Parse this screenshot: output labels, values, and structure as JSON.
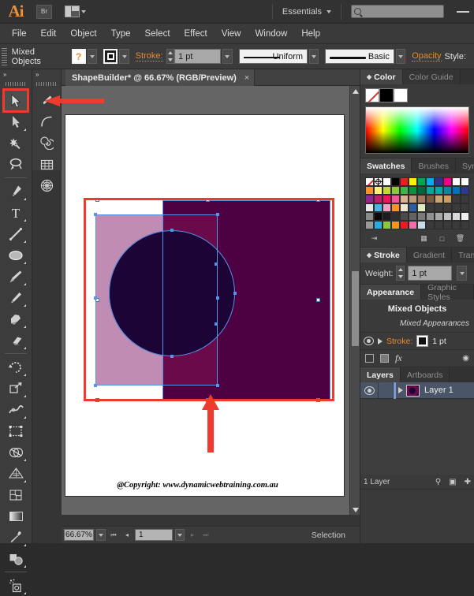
{
  "app": {
    "name": "Ai",
    "logo_color": "#e8913a"
  },
  "titlebar": {
    "bridge_label": "Br",
    "arrange_name": "arrange-documents",
    "workspace": "Essentials",
    "search_placeholder": ""
  },
  "menubar": {
    "items": [
      "File",
      "Edit",
      "Object",
      "Type",
      "Select",
      "Effect",
      "View",
      "Window",
      "Help"
    ]
  },
  "controlbar": {
    "selection_label": "Mixed Objects",
    "fill_glyph": "?",
    "stroke_label": "Stroke:",
    "stroke_weight": "1 pt",
    "variable_width_profile": "Uniform",
    "brush_definition": "Basic",
    "opacity_label": "Opacity",
    "style_label": "Style:"
  },
  "toolbar": {
    "column1": [
      {
        "name": "selection-tool",
        "selected": true
      },
      {
        "name": "direct-selection-tool",
        "selected": false
      },
      {
        "name": "magic-wand-tool",
        "selected": false
      },
      {
        "name": "lasso-tool",
        "selected": false
      },
      {
        "name": "pen-tool",
        "selected": false
      },
      {
        "name": "type-tool",
        "selected": false
      },
      {
        "name": "line-segment-tool",
        "selected": false
      },
      {
        "name": "ellipse-tool",
        "selected": false
      },
      {
        "name": "paintbrush-tool",
        "selected": false
      },
      {
        "name": "pencil-tool",
        "selected": false
      },
      {
        "name": "blob-brush-tool",
        "selected": false
      },
      {
        "name": "eraser-tool",
        "selected": false
      },
      {
        "name": "rotate-tool",
        "selected": false
      },
      {
        "name": "scale-tool",
        "selected": false
      },
      {
        "name": "width-tool",
        "selected": false
      },
      {
        "name": "free-transform-tool",
        "selected": false
      },
      {
        "name": "shape-builder-tool",
        "selected": false
      },
      {
        "name": "perspective-grid-tool",
        "selected": false
      },
      {
        "name": "mesh-tool",
        "selected": false
      },
      {
        "name": "gradient-tool",
        "selected": false
      },
      {
        "name": "eyedropper-tool",
        "selected": false
      },
      {
        "name": "blend-tool",
        "selected": false
      },
      {
        "name": "symbol-sprayer-tool",
        "selected": false
      }
    ],
    "column2": [
      {
        "name": "paintbrush-tool",
        "selected": false
      },
      {
        "name": "arc-tool",
        "selected": false
      },
      {
        "name": "spiral-tool",
        "selected": false
      },
      {
        "name": "rectangular-grid-tool",
        "selected": false
      },
      {
        "name": "polar-grid-tool",
        "selected": false
      }
    ]
  },
  "document": {
    "tab_title": "ShapeBuilder* @ 66.67% (RGB/Preview)",
    "close_glyph": "×",
    "watermark": "@Copyright: www.dynamicwebtraining.com.au"
  },
  "artwork": {
    "rect_right_color": "#4d0042",
    "rect_left_color": "#c18cb3",
    "rect_mid_color": "#6b0a4a",
    "circle_color": "#1d0437",
    "selection_color": "#5a92e8",
    "highlight_color": "#ef3b2d"
  },
  "statusbar": {
    "zoom": "66.67%",
    "page": "1",
    "status": "Selection"
  },
  "panels": {
    "color": {
      "tabs": [
        {
          "label": "Color",
          "active": true
        },
        {
          "label": "Color Guide",
          "active": false
        }
      ],
      "chips": [
        "none",
        "#000000",
        "#ffffff"
      ]
    },
    "swatches": {
      "tabs": [
        {
          "label": "Swatches",
          "active": true
        },
        {
          "label": "Brushes",
          "active": false
        },
        {
          "label": "Symbo",
          "active": false
        }
      ],
      "rows": [
        [
          "none",
          "registration",
          "#ffffff",
          "#000000",
          "#ed1c24",
          "#fff200",
          "#00a651",
          "#00aeef",
          "#2e3192",
          "#ec008c",
          "#ffffff",
          "#ffffff"
        ],
        [
          "#f7941e",
          "#fff568",
          "#c4d82e",
          "#8dc63f",
          "#39b54a",
          "#009444",
          "#006838",
          "#00a79d",
          "#00a8a8",
          "#0089a0",
          "#0071bc",
          "#2b3990"
        ],
        [
          "#92278f",
          "#bf1e6d",
          "#ed145b",
          "#f0539a",
          "#d5b391",
          "#bd9a7a",
          "#a0795c",
          "#7b5a42",
          "#caa472",
          "#c99d5f",
          "#3a3a3a",
          "#3a3a3a"
        ],
        [
          "#e8e8e8",
          "#4ab4e6",
          "#f2a0c4",
          "#f7941e",
          "#efe7c8",
          "#2a5fa8",
          "#ddecc0",
          "#3a3a3a",
          "#3a3a3a",
          "#3a3a3a",
          "#3a3a3a",
          "#3a3a3a"
        ],
        [
          "#8a8a8a",
          "#0a0a0a",
          "#1c1c1c",
          "#2e2e2e",
          "#4a4a4a",
          "#636363",
          "#7a7a7a",
          "#919191",
          "#a8a8a8",
          "#c0c0c0",
          "#d8d8d8",
          "#f0f0f0"
        ],
        [
          "#9a9a9a",
          "#29abe2",
          "#8cc63f",
          "#f7941e",
          "#ed1c24",
          "#f06eaa",
          "#c6dce6",
          "#3a3a3a",
          "#3a3a3a",
          "#3a3a3a",
          "#3a3a3a",
          "#3a3a3a"
        ]
      ]
    },
    "stroke": {
      "tabs": [
        {
          "label": "Stroke",
          "active": true
        },
        {
          "label": "Gradient",
          "active": false
        },
        {
          "label": "Transp",
          "active": false
        }
      ],
      "weight_label": "Weight:",
      "weight_value": "1 pt"
    },
    "appearance": {
      "tabs": [
        {
          "label": "Appearance",
          "active": true
        },
        {
          "label": "Graphic Styles",
          "active": false
        }
      ],
      "title": "Mixed Objects",
      "subtitle": "Mixed Appearances",
      "stroke_label": "Stroke:",
      "stroke_value": "1 pt",
      "fx_label": "fx"
    },
    "layers": {
      "tabs": [
        {
          "label": "Layers",
          "active": true
        },
        {
          "label": "Artboards",
          "active": false
        }
      ],
      "rows": [
        {
          "name": "Layer 1"
        }
      ],
      "footer_count": "1 Layer"
    }
  }
}
